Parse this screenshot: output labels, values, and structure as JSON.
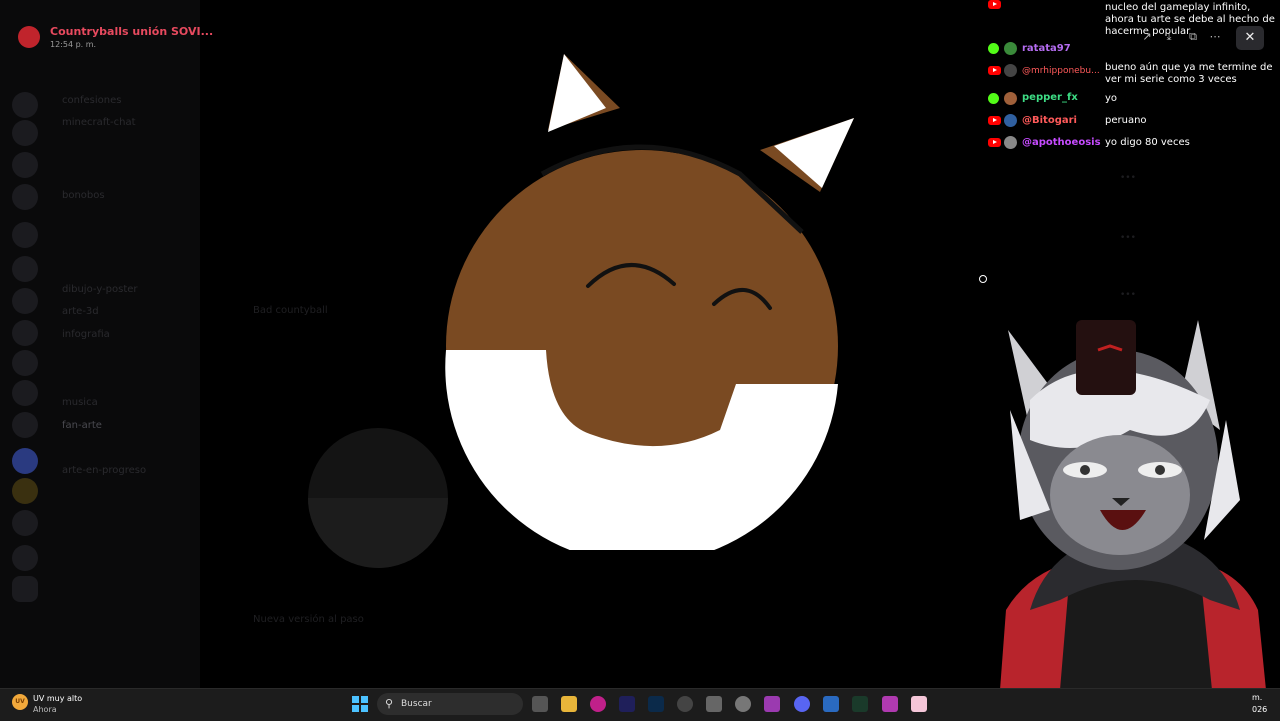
{
  "discord": {
    "server_name": "Countryballs unión SOVI...",
    "time": "12:54 p. m.",
    "channels": [
      "confesiones",
      "minecraft-chat",
      "bonobos",
      "dibujo-y-poster",
      "arte-3d",
      "infografia",
      "musica",
      "fan-arte",
      "arte-en-progreso"
    ],
    "bottom_label": "Nueva versión al paso",
    "post_label": "Bad countyball"
  },
  "chat": {
    "messages": [
      {
        "platform": "youtube",
        "user": "",
        "text": "nucleo del gameplay infinito, ahora tu arte se debe al hecho de hacerme popular",
        "color": "#ff5a5a"
      },
      {
        "platform": "kick",
        "user": "ratata97",
        "text": "",
        "color": "#b46cf0"
      },
      {
        "platform": "youtube",
        "user": "@mrhipponebu...",
        "text": "bueno aún que ya me termine de ver mi serie como 3 veces",
        "color": "#ff5a5a"
      },
      {
        "platform": "kick",
        "user": "pepper_fx",
        "text": "yo",
        "color": "#3ddc84"
      },
      {
        "platform": "youtube",
        "user": "@Bitogari",
        "text": "peruano",
        "color": "#ff5a5a"
      },
      {
        "platform": "youtube",
        "user": "@apothoeosis",
        "text": "yo digo 80 veces",
        "color": "#c64bff"
      }
    ],
    "close_icon": "close-icon"
  },
  "taskbar": {
    "weather_title": "UV muy alto",
    "weather_sub": "Ahora",
    "search_placeholder": "Buscar",
    "clock_time": "m.",
    "clock_date": "026"
  }
}
